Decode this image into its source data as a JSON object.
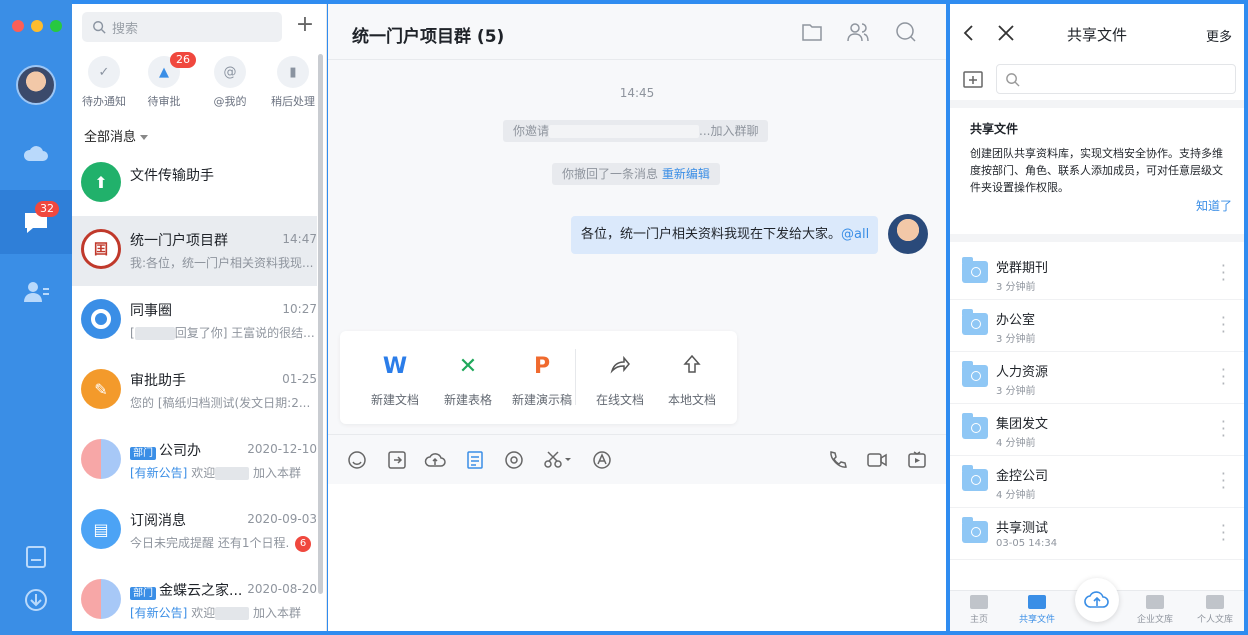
{
  "rail": {
    "badge": "32"
  },
  "convlist": {
    "search_placeholder": "搜索",
    "quick": [
      {
        "label": "待办通知",
        "badge": ""
      },
      {
        "label": "待审批",
        "badge": "26"
      },
      {
        "label": "@我的",
        "badge": ""
      },
      {
        "label": "稍后处理",
        "badge": ""
      }
    ],
    "filter": "全部消息",
    "items": [
      {
        "title": "文件传输助手",
        "time": "",
        "sub": "",
        "dept": "",
        "tag": ""
      },
      {
        "title": "统一门户项目群",
        "time": "14:47",
        "sub": "我:各位，统一门户相关资料我现...",
        "dept": "",
        "tag": ""
      },
      {
        "title": "同事圈",
        "time": "10:27",
        "sub": "回复了你] 王富说的很结...",
        "dept": "",
        "tag": ""
      },
      {
        "title": "审批助手",
        "time": "01-25",
        "sub": "您的 [稿纸归档测试(发文日期:2...",
        "dept": "",
        "tag": ""
      },
      {
        "title": "公司办",
        "time": "2020-12-10",
        "sub": "欢迎",
        "sub2": "加入本群",
        "dept": "部门",
        "tag": "[有新公告]"
      },
      {
        "title": "订阅消息",
        "time": "2020-09-03",
        "sub": "今日未完成提醒 还有1个日程...",
        "dept": "",
        "tag": "",
        "unread": "6"
      },
      {
        "title": "金蝶云之家...",
        "time": "2020-08-20",
        "sub": "欢迎",
        "sub2": "加入本群",
        "dept": "部门",
        "tag": "[有新公告]"
      }
    ]
  },
  "chat": {
    "title": "统一门户项目群 (5)",
    "time": "14:45",
    "invite_prefix": "你邀请",
    "invite_suffix": "...加入群聊",
    "recall_text": "你撤回了一条消息",
    "recall_link": "重新编辑",
    "message": "各位，统一门户相关资料我现在下发给大家。",
    "mention": "@all",
    "file_actions": [
      {
        "label": "新建文档",
        "glyph": "W",
        "color": "#2b7de9"
      },
      {
        "label": "新建表格",
        "glyph": "X",
        "color": "#1fa85a"
      },
      {
        "label": "新建演示稿",
        "glyph": "P",
        "color": "#f06a2e"
      },
      {
        "label": "在线文档",
        "glyph": "share-icon",
        "color": "#555555"
      },
      {
        "label": "本地文档",
        "glyph": "upload-arrow-icon",
        "color": "#555555"
      }
    ]
  },
  "share": {
    "title": "共享文件",
    "more": "更多",
    "intro_title": "共享文件",
    "intro_text": "创建团队共享资料库，实现文档安全协作。支持多维度按部门、角色、联系人添加成员，可对任意层级文件夹设置操作权限。",
    "intro_ok": "知道了",
    "folders": [
      {
        "name": "党群期刊",
        "time": "3 分钟前"
      },
      {
        "name": "办公室",
        "time": "3 分钟前"
      },
      {
        "name": "人力资源",
        "time": "3 分钟前"
      },
      {
        "name": "集团发文",
        "time": "4 分钟前"
      },
      {
        "name": "金控公司",
        "time": "4 分钟前"
      },
      {
        "name": "共享测试",
        "time": "03-05 14:34"
      }
    ],
    "tabs": [
      {
        "label": "主页"
      },
      {
        "label": "共享文件"
      },
      {
        "label": "企业文库"
      },
      {
        "label": "个人文库"
      }
    ]
  },
  "colors": {
    "accent": "#3a8ee6",
    "badge": "#f0483e"
  }
}
